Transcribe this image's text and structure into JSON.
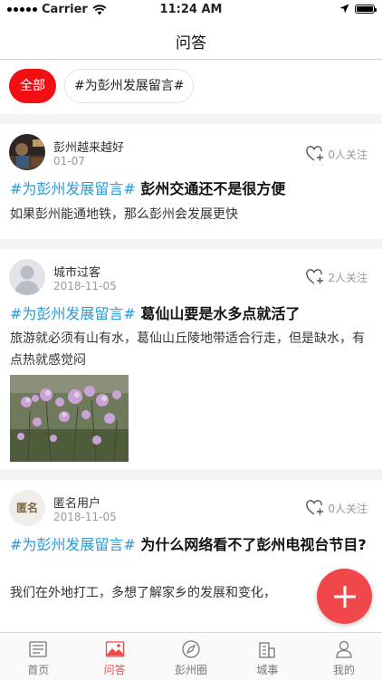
{
  "status_bar": {
    "carrier": "Carrier",
    "time": "11:24 AM"
  },
  "nav": {
    "title": "问答"
  },
  "filters": [
    {
      "label": "全部",
      "active": true
    },
    {
      "label": "#为彭州发展留言#",
      "active": false
    }
  ],
  "posts": [
    {
      "username": "彭州越来越好",
      "date": "01-07",
      "follow": "0人关注",
      "hashtag": "#为彭州发展留言#",
      "title": "彭州交通还不是很方便",
      "content": "如果彭州能通地铁，那么彭州会发展更快"
    },
    {
      "username": "城市过客",
      "date": "2018-11-05",
      "follow": "2人关注",
      "hashtag": "#为彭州发展留言#",
      "title": "葛仙山要是水多点就活了",
      "content": "旅游就必须有山有水，葛仙山丘陵地带适合行走，但是缺水，有点热就感觉闷"
    },
    {
      "username": "匿名用户",
      "avatar_text": "匿名",
      "date": "2018-11-05",
      "follow": "0人关注",
      "hashtag": "#为彭州发展留言#",
      "title": "为什么网络看不了彭州电视台节目?",
      "content": "我们在外地打工，多想了解家乡的发展和变化，"
    }
  ],
  "tabs": [
    {
      "label": "首页",
      "icon": "news-icon",
      "active": false
    },
    {
      "label": "问答",
      "icon": "image-icon",
      "active": true
    },
    {
      "label": "彭州圈",
      "icon": "compass-icon",
      "active": false
    },
    {
      "label": "城事",
      "icon": "building-icon",
      "active": false
    },
    {
      "label": "我的",
      "icon": "person-icon",
      "active": false
    }
  ],
  "colors": {
    "accent": "#f20f14",
    "hashtag": "#2a9bd8",
    "fab": "#f0474a",
    "muted": "#999999"
  }
}
